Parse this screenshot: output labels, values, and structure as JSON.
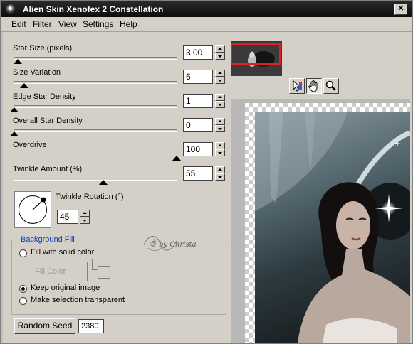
{
  "window": {
    "title": "Alien Skin Xenofex 2 Constellation",
    "close_symbol": "✕"
  },
  "menu": [
    "Edit",
    "Filter",
    "View",
    "Settings",
    "Help"
  ],
  "sliders": [
    {
      "label": "Star Size (pixels)",
      "value": "3.00",
      "fraction": 0.02
    },
    {
      "label": "Size Variation",
      "value": "6",
      "fraction": 0.06
    },
    {
      "label": "Edge Star Density",
      "value": "1",
      "fraction": 0.0
    },
    {
      "label": "Overall Star Density",
      "value": "0",
      "fraction": 0.0
    },
    {
      "label": "Overdrive",
      "value": "100",
      "fraction": 1.0
    },
    {
      "label": "Twinkle Amount (%)",
      "value": "55",
      "fraction": 0.55
    }
  ],
  "twinkle_rotation": {
    "label": "Twinkle Rotation (°)",
    "value": "45"
  },
  "background_fill": {
    "title": "Background Fill",
    "options": [
      {
        "label": "Fill with solid color",
        "checked": false
      },
      {
        "label": "Keep original image",
        "checked": true
      },
      {
        "label": "Make selection transparent",
        "checked": false
      }
    ],
    "fill_color_label": "Fill Color"
  },
  "random_seed": {
    "label": "Random Seed",
    "value": "2380"
  },
  "watermark": "© by Christa",
  "tools": [
    "selection-arrow-icon",
    "hand-icon",
    "magnifier-icon"
  ],
  "colors": {
    "titlebar": "#111111",
    "group_title": "#0f3fb8",
    "preview_frame": "#e02020"
  }
}
